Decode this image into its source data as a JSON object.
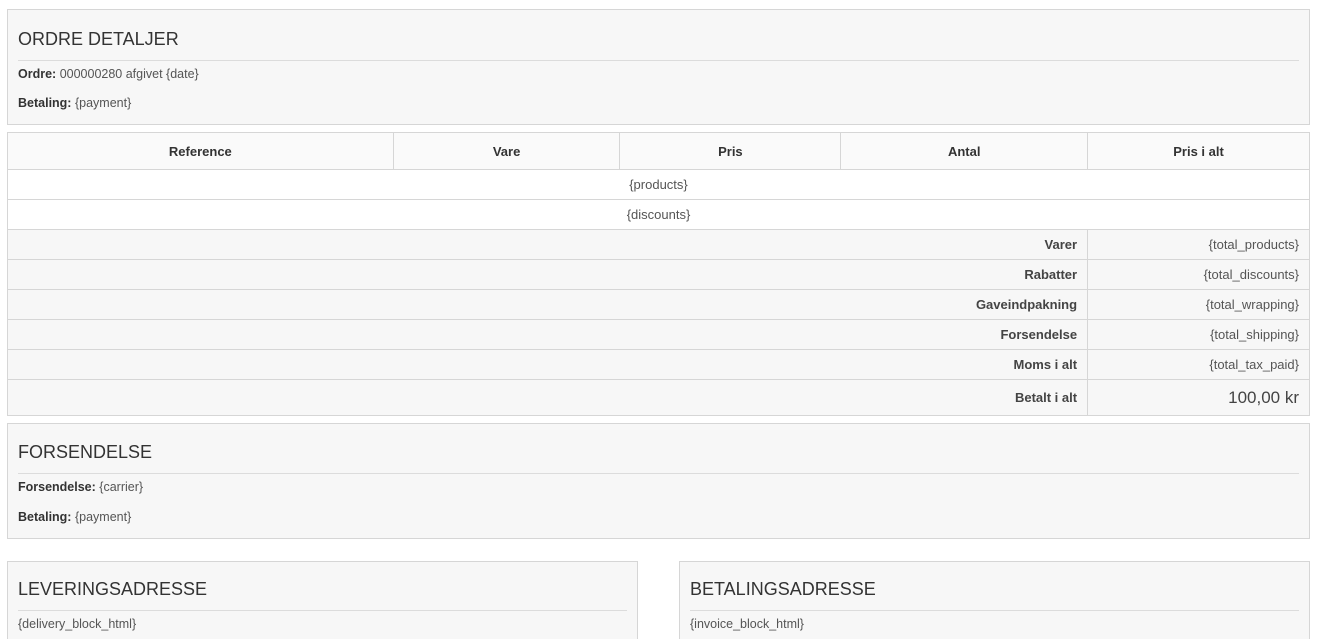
{
  "order_details": {
    "title": "ORDRE DETALJER",
    "order_label": "Ordre:",
    "order_value": "000000280 afgivet {date}",
    "payment_label": "Betaling:",
    "payment_value": "{payment}"
  },
  "table": {
    "headers": [
      "Reference",
      "Vare",
      "Pris",
      "Antal",
      "Pris i alt"
    ],
    "products_placeholder": "{products}",
    "discounts_placeholder": "{discounts}",
    "summary": [
      {
        "label": "Varer",
        "value": "{total_products}"
      },
      {
        "label": "Rabatter",
        "value": "{total_discounts}"
      },
      {
        "label": "Gaveindpakning",
        "value": "{total_wrapping}"
      },
      {
        "label": "Forsendelse",
        "value": "{total_shipping}"
      },
      {
        "label": "Moms i alt",
        "value": "{total_tax_paid}"
      },
      {
        "label": "Betalt i alt",
        "value": "100,00 kr"
      }
    ]
  },
  "shipping": {
    "title": "FORSENDELSE",
    "carrier_label": "Forsendelse:",
    "carrier_value": "{carrier}",
    "payment_label": "Betaling:",
    "payment_value": "{payment}"
  },
  "delivery_address": {
    "title": "LEVERINGSADRESSE",
    "value": "{delivery_block_html}"
  },
  "invoice_address": {
    "title": "BETALINGSADRESSE",
    "value": "{invoice_block_html}"
  }
}
